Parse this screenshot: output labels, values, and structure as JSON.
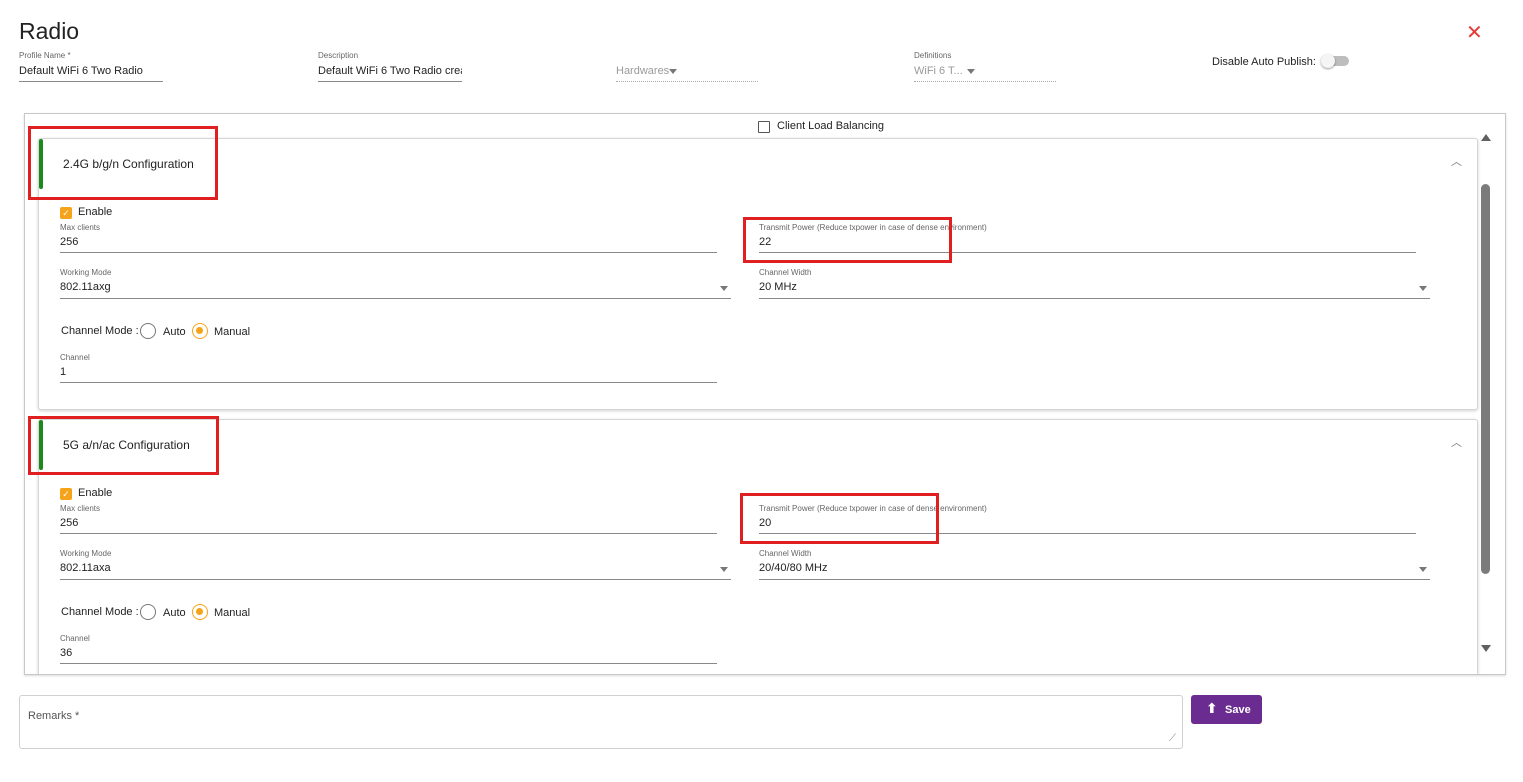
{
  "header": {
    "title": "Radio",
    "profile_name_label": "Profile Name *",
    "profile_name_value": "Default WiFi 6 Two Radio",
    "description_label": "Description",
    "description_value": "Default WiFi 6 Two Radio crea",
    "hardwares_placeholder": "Hardwares",
    "definitions_label": "Definitions",
    "definitions_value": "WiFi 6 T...",
    "disable_auto_publish_label": "Disable Auto Publish:",
    "disable_auto_publish": false
  },
  "top_option": {
    "label": "Client Load Balancing",
    "checked": false
  },
  "sections": [
    {
      "title": "2.4G b/g/n Configuration",
      "enable_label": "Enable",
      "enabled": true,
      "max_clients_label": "Max clients",
      "max_clients": "256",
      "transmit_power_label": "Transmit Power (Reduce txpower in case of dense environment)",
      "transmit_power": "22",
      "working_mode_label": "Working Mode",
      "working_mode": "802.11axg",
      "channel_width_label": "Channel Width",
      "channel_width": "20 MHz",
      "channel_mode_label": "Channel Mode :",
      "auto_label": "Auto",
      "manual_label": "Manual",
      "channel_mode": "Manual",
      "channel_label": "Channel",
      "channel": "1"
    },
    {
      "title": "5G a/n/ac Configuration",
      "enable_label": "Enable",
      "enabled": true,
      "max_clients_label": "Max clients",
      "max_clients": "256",
      "transmit_power_label": "Transmit Power (Reduce txpower in case of dense environment)",
      "transmit_power": "20",
      "working_mode_label": "Working Mode",
      "working_mode": "802.11axa",
      "channel_width_label": "Channel Width",
      "channel_width": "20/40/80 MHz",
      "channel_mode_label": "Channel Mode :",
      "auto_label": "Auto",
      "manual_label": "Manual",
      "channel_mode": "Manual",
      "channel_label": "Channel",
      "channel": "36"
    }
  ],
  "footer": {
    "remarks_placeholder": "Remarks *",
    "save_label": "Save"
  },
  "colors": {
    "accent": "#f5a31a",
    "save_button": "#6a2c91",
    "section_bar": "#1b8a1b",
    "close_icon": "#e53935",
    "highlight_box": "#e02020"
  }
}
